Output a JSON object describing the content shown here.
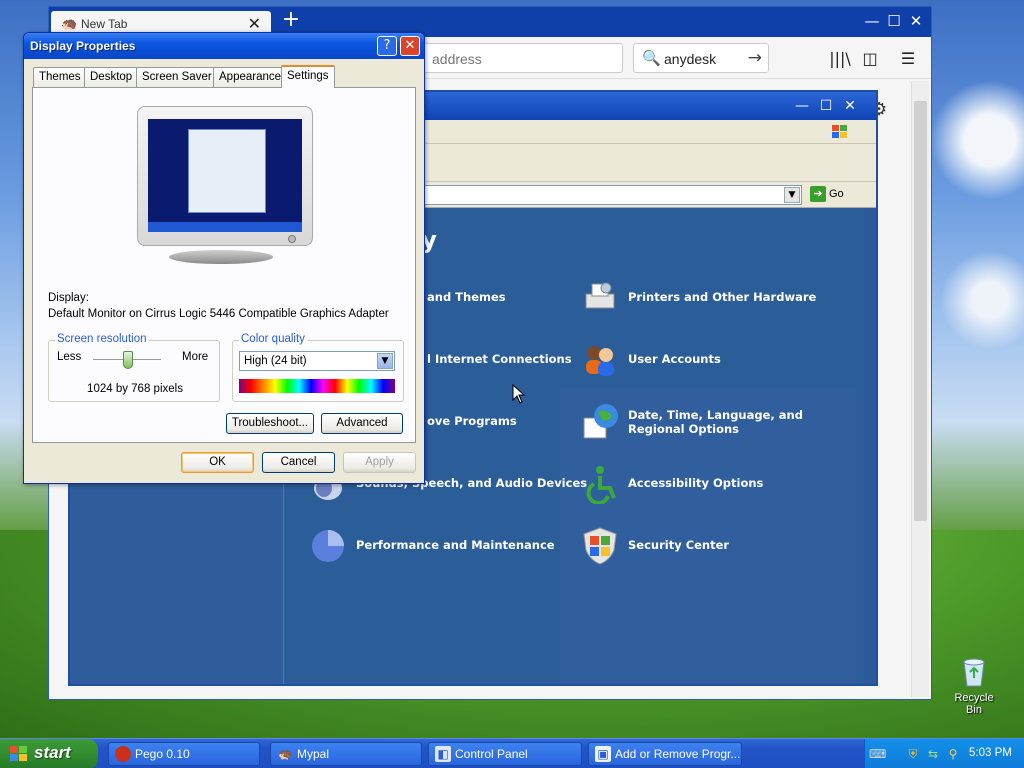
{
  "desktop": {
    "recycle_bin_label": "Recycle Bin"
  },
  "firefox": {
    "tab_title": "New Tab",
    "new_tab_symbol": "+",
    "url_placeholder": "address",
    "search_value": "anydesk",
    "window_buttons": [
      "—",
      "☐",
      "✕"
    ]
  },
  "control_panel": {
    "heading_fragment": "tegory",
    "address_go_label": "Go",
    "categories_left": [
      {
        "label": "and Themes"
      },
      {
        "label": "l Internet Connections"
      },
      {
        "label": "ove Programs"
      },
      {
        "label": "Sounds, Speech, and Audio Devices"
      },
      {
        "label": "Performance and Maintenance"
      }
    ],
    "categories_right": [
      {
        "label": "Printers and Other Hardware"
      },
      {
        "label": "User Accounts"
      },
      {
        "label": "Date, Time, Language, and Regional Options"
      },
      {
        "label": "Accessibility Options"
      },
      {
        "label": "Security Center"
      }
    ]
  },
  "display_properties": {
    "title": "Display Properties",
    "help_symbol": "?",
    "close_symbol": "✕",
    "tabs": [
      "Themes",
      "Desktop",
      "Screen Saver",
      "Appearance",
      "Settings"
    ],
    "active_tab": "Settings",
    "display_label": "Display:",
    "display_value": "Default Monitor on Cirrus Logic 5446 Compatible Graphics Adapter",
    "resolution": {
      "group_title": "Screen resolution",
      "less_label": "Less",
      "more_label": "More",
      "value_text": "1024 by 768 pixels"
    },
    "color_quality": {
      "group_title": "Color quality",
      "selected": "High (24 bit)"
    },
    "buttons": {
      "troubleshoot": "Troubleshoot...",
      "advanced": "Advanced",
      "ok": "OK",
      "cancel": "Cancel",
      "apply": "Apply"
    }
  },
  "taskbar": {
    "start_label": "start",
    "items": [
      {
        "label": "Pego 0.10",
        "icon": "pego-icon"
      },
      {
        "label": "Mypal",
        "icon": "mypal-icon"
      },
      {
        "label": "Control Panel",
        "icon": "control-panel-icon"
      },
      {
        "label": "Add or Remove Progr...",
        "icon": "add-remove-icon"
      }
    ],
    "clock": "5:03 PM"
  },
  "colors": {
    "xp_blue": "#0b55e0",
    "start_green": "#2f8a2c",
    "cp_blue": "#2b5d98"
  }
}
